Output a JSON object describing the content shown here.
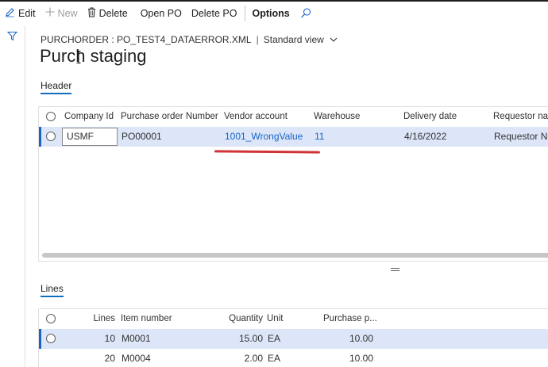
{
  "toolbar": {
    "edit": "Edit",
    "new": "New",
    "delete": "Delete",
    "open_po": "Open PO",
    "delete_po": "Delete PO",
    "options": "Options"
  },
  "page": {
    "caption_form": "PURCHORDER : PO_TEST4_DATAERROR.XML",
    "view_name": "Standard view",
    "title": "Purch staging"
  },
  "header_section": {
    "tab": "Header",
    "columns": [
      "Company Id",
      "Purchase order Number",
      "Vendor account",
      "Warehouse",
      "Delivery date",
      "Requestor nar"
    ],
    "rows": [
      {
        "company_id": "USMF",
        "po_number": "PO00001",
        "vendor_account": "1001_WrongValue",
        "warehouse": "11",
        "delivery_date": "4/16/2022",
        "requestor": "Requestor Na"
      }
    ]
  },
  "lines_section": {
    "tab": "Lines",
    "columns": [
      "Lines",
      "Item number",
      "Quantity",
      "Unit",
      "Purchase p..."
    ],
    "rows": [
      {
        "line": "10",
        "item": "M0001",
        "qty": "15.00",
        "unit": "EA",
        "price": "10.00"
      },
      {
        "line": "20",
        "item": "M0004",
        "qty": "2.00",
        "unit": "EA",
        "price": "10.00"
      }
    ]
  },
  "colors": {
    "accent": "#106ebe",
    "link": "#1764c6",
    "selected_row": "#dce6f8",
    "annotation_underline": "#d13438"
  }
}
